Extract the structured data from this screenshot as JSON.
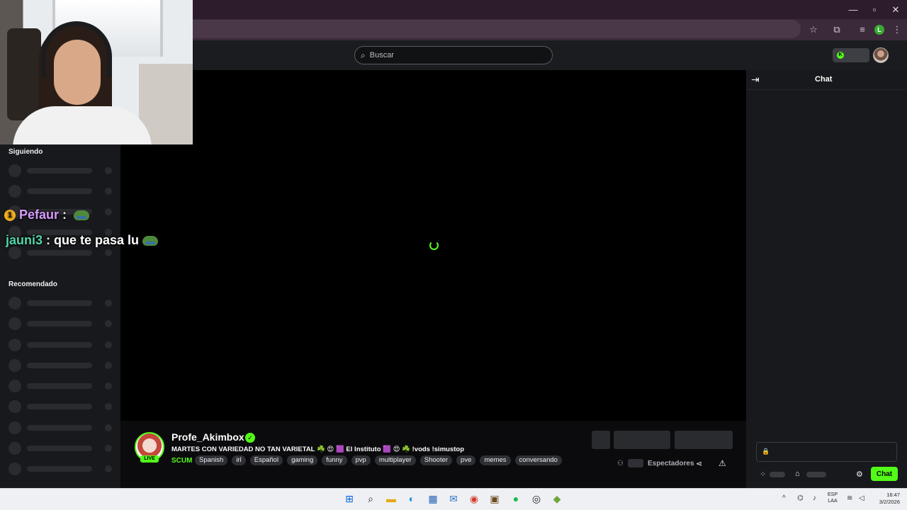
{
  "browser": {
    "window_controls": {
      "minimize": "—",
      "maximize": "▫",
      "close": "✕"
    },
    "profile_initial": "L"
  },
  "topbar": {
    "search_placeholder": "Buscar",
    "kick_letter": "K"
  },
  "sidebar": {
    "following_heading": "Siguiendo",
    "recommended_heading": "Recomendado"
  },
  "overlay_chat": [
    {
      "badge": "1",
      "user": "Pefaur",
      "user_color": "#d79bff",
      "message": ""
    },
    {
      "badge": "",
      "user": "jauni3",
      "user_color": "#52d6a8",
      "message": "que te pasa lu"
    }
  ],
  "stream": {
    "streamer_name": "Profe_Akimbox",
    "live_label": "LIVE",
    "title": "MARTES CON VARIEDAD NO TAN VARIETAL ☘️ 😍 🟪 El Instituto 🟪 😍 ☘️ !vods !simustop",
    "category": "SCUM",
    "tags": [
      "Spanish",
      "irl",
      "Español",
      "gaming",
      "funny",
      "pvp",
      "multiplayer",
      "Shooter",
      "pve",
      "memes",
      "conversando"
    ],
    "viewers_label": "Espectadores",
    "accent_color": "#53fc18"
  },
  "chat": {
    "title": "Chat",
    "send_label": "Chat"
  },
  "taskbar": {
    "lang_line1": "ESP",
    "lang_line2": "LAA",
    "time": "16:47",
    "date": "3/2/2026"
  }
}
